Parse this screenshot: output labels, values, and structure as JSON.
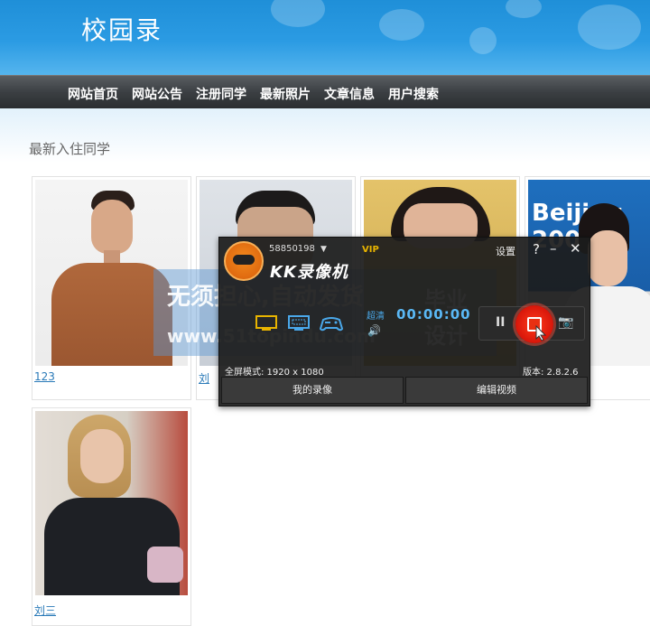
{
  "site": {
    "title": "校园录"
  },
  "nav": {
    "items": [
      "网站首页",
      "网站公告",
      "注册同学",
      "最新照片",
      "文章信息",
      "用户搜索"
    ]
  },
  "section": {
    "title": "最新入住同学"
  },
  "students": [
    {
      "name": "123"
    },
    {
      "name": "刘"
    },
    {
      "name": ""
    },
    {
      "name": ""
    },
    {
      "name": "刘三"
    }
  ],
  "watermark": {
    "line1": "无须担心,自动发货",
    "line2": "www.51topindu.com",
    "badge1": "毕业",
    "badge2": "设计"
  },
  "recorder": {
    "user_id": "58850198",
    "dropdown": "▼",
    "vip": "VIP",
    "settings": "设置",
    "help": "?",
    "minimize": "–",
    "close": "✕",
    "brand": "KK录像机",
    "quality": "超清",
    "volume_icon": "🔊",
    "timer": "00:00:00",
    "pause": "II",
    "camera": "📷",
    "mode": "全屏模式: 1920 x 1080",
    "version": "版本: 2.8.2.6",
    "my_videos": "我的录像",
    "edit_video": "编辑视频",
    "colors": {
      "accent": "#4aa8ea",
      "stop": "#e02010",
      "vip": "#e8b400"
    }
  }
}
